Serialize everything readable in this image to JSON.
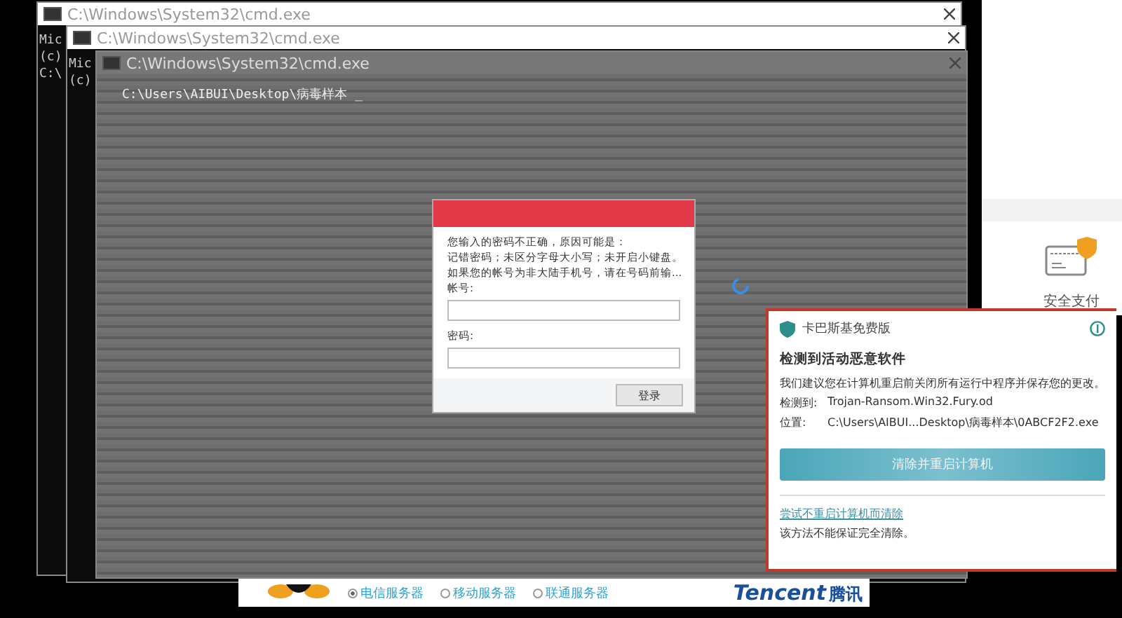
{
  "cmd_windows": [
    {
      "title": "C:\\Windows\\System32\\cmd.exe",
      "lines": [
        "Mic",
        "(c)",
        "C:\\"
      ]
    },
    {
      "title": "C:\\Windows\\System32\\cmd.exe",
      "lines": [
        "Mic",
        "(c)"
      ]
    },
    {
      "title": "C:\\Windows\\System32\\cmd.exe",
      "lines": [
        "C:\\Users\\AIBUI\\Desktop\\病毒样本 _"
      ]
    }
  ],
  "login_dialog": {
    "message": [
      "您输入的密码不正确，原因可能是：",
      "记错密码；未区分字母大小写；未开启小键盘。",
      "如果您的帐号为非大陆手机号，请在号码前输..."
    ],
    "account_label": "帐号:",
    "password_label": "密码:",
    "login_button": "登录"
  },
  "payment_panel": {
    "label": "安全支付"
  },
  "antivirus_popup": {
    "product": "卡巴斯基免费版",
    "heading": "检测到活动恶意软件",
    "message": "我们建议您在计算机重启前关闭所有运行中程序并保存您的更改。",
    "detected_label": "检测到:",
    "detected_value": "Trojan-Ransom.Win32.Fury.od",
    "location_label": "位置:",
    "location_value": "C:\\Users\\AIBUI...Desktop\\病毒样本\\0ABCF2F2.exe",
    "primary_button": "清除并重启计算机",
    "link": "尝试不重启计算机而清除",
    "note": "该方法不能保证完全清除。"
  },
  "server_bar": {
    "options": [
      {
        "label": "电信服务器",
        "selected": true
      },
      {
        "label": "移动服务器",
        "selected": false
      },
      {
        "label": "联通服务器",
        "selected": false
      }
    ],
    "logo_text": "Tencent",
    "logo_text_cn": "腾讯"
  }
}
